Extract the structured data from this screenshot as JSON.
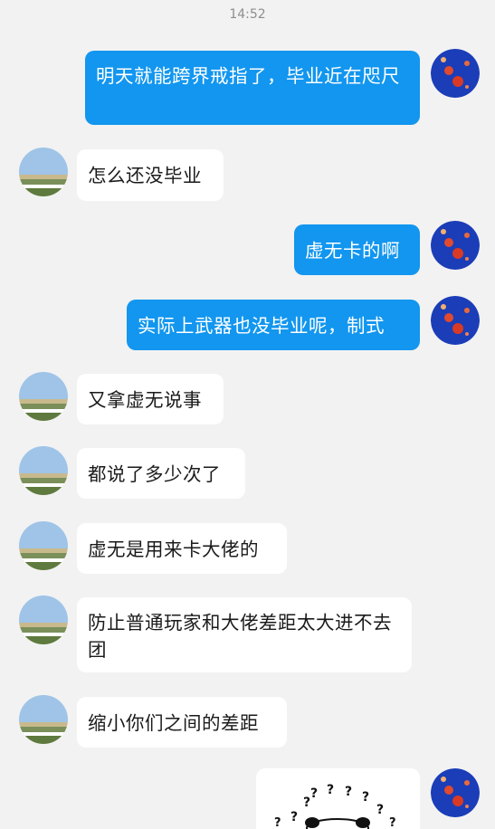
{
  "status": {
    "time": "14:52"
  },
  "messages": [
    {
      "id": "m1",
      "side": "out",
      "text": "明天就能跨界戒指了，毕业近在咫尺"
    },
    {
      "id": "m2",
      "side": "in",
      "text": "怎么还没毕业"
    },
    {
      "id": "m3",
      "side": "out",
      "text": "虚无卡的啊"
    },
    {
      "id": "m4",
      "side": "out",
      "text": "实际上武器也没毕业呢，制式"
    },
    {
      "id": "m5",
      "side": "in",
      "text": "又拿虚无说事"
    },
    {
      "id": "m6",
      "side": "in",
      "text": "都说了多少次了"
    },
    {
      "id": "m7",
      "side": "in",
      "text": "虚无是用来卡大佬的"
    },
    {
      "id": "m8",
      "side": "in",
      "text": "防止普通玩家和大佬差距太大进不去团"
    },
    {
      "id": "m9",
      "side": "in",
      "text": "缩小你们之间的差距"
    },
    {
      "id": "m10",
      "side": "out",
      "type": "sticker",
      "sticker": "panda-confused-sticker"
    }
  ],
  "colors": {
    "background": "#f2f2f2",
    "outgoing_bubble": "#1296ef",
    "incoming_bubble": "#ffffff",
    "timestamp_text": "#8e8e8e"
  }
}
